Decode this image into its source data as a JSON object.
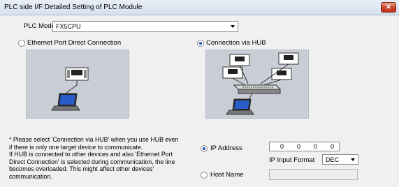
{
  "window": {
    "title": "PLC side I/F Detailed Setting of PLC Module",
    "close_label": "✕"
  },
  "plc_mode": {
    "label": "PLC Mode",
    "value": "FX5CPU"
  },
  "connection_options": {
    "direct_label": "Ethernet Port Direct Connection",
    "direct_selected": false,
    "hub_label": "Connection via HUB",
    "hub_selected": true
  },
  "note": {
    "lines": [
      "* Please select 'Connection via HUB' when you use HUB even",
      "if there is only one target device to communicate.",
      "If HUB is connected to other devices and also 'Ethernet Port",
      "Direct Connection' is selected during communication, the line",
      "becomes overloaded. This might affect other devices'",
      "communication."
    ]
  },
  "address": {
    "ip_label": "IP Address",
    "ip_selected": true,
    "octets": [
      "0",
      "0",
      "0",
      "0"
    ],
    "format_label": "IP Input Format",
    "format_value": "DEC",
    "host_label": "Host Name",
    "host_selected": false,
    "host_value": ""
  },
  "colors": {
    "diagram_bg": "#c8cdd6",
    "radio_fill": "#1a55b0",
    "close_red": "#c0311a"
  }
}
